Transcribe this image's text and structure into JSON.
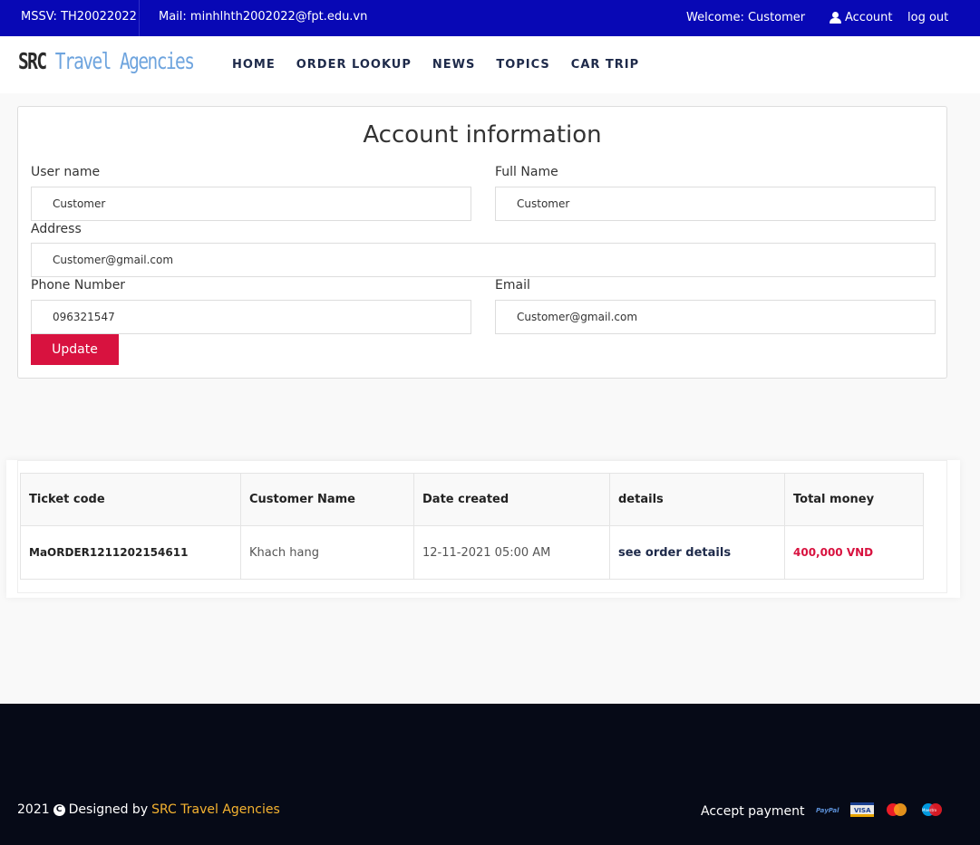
{
  "topbar": {
    "mssv": "MSSV: TH20022022",
    "mail": "Mail: minhlhth2002022@fpt.edu.vn",
    "welcome": "Welcome: Customer",
    "account": "Account",
    "logout": "log out"
  },
  "header": {
    "logo_src": "SRC",
    "logo_rest": " Travel Agencies",
    "nav": [
      "HOME",
      "ORDER LOOKUP",
      "NEWS",
      "TOPICS",
      "CAR TRIP"
    ]
  },
  "account_form": {
    "title": "Account information",
    "username_label": "User name",
    "username_value": "Customer",
    "fullname_label": "Full Name",
    "fullname_value": "Customer",
    "address_label": "Address",
    "address_value": "Customer@gmail.com",
    "phone_label": "Phone Number",
    "phone_value": "096321547",
    "email_label": "Email",
    "email_value": "Customer@gmail.com",
    "update_label": "Update"
  },
  "orders": {
    "headers": [
      "Ticket code",
      "Customer Name",
      "Date created",
      "details",
      "Total money"
    ],
    "rows": [
      {
        "code": "MaORDER1211202154611",
        "customer": "Khach hang",
        "date": "12-11-2021 05:00 AM",
        "details": "see order details",
        "total": "400,000 VND"
      }
    ]
  },
  "footer": {
    "year": "2021",
    "designed_by": "Designed by",
    "brand": "SRC Travel Agencies",
    "accept_payment": "Accept payment",
    "payment_icons": [
      "paypal-icon",
      "visa-icon",
      "mastercard-icon",
      "maestro-icon"
    ]
  },
  "colors": {
    "topbar": "#0808b5",
    "accent": "#d8123f",
    "footer": "#060a17",
    "brand": "#f5b330"
  }
}
